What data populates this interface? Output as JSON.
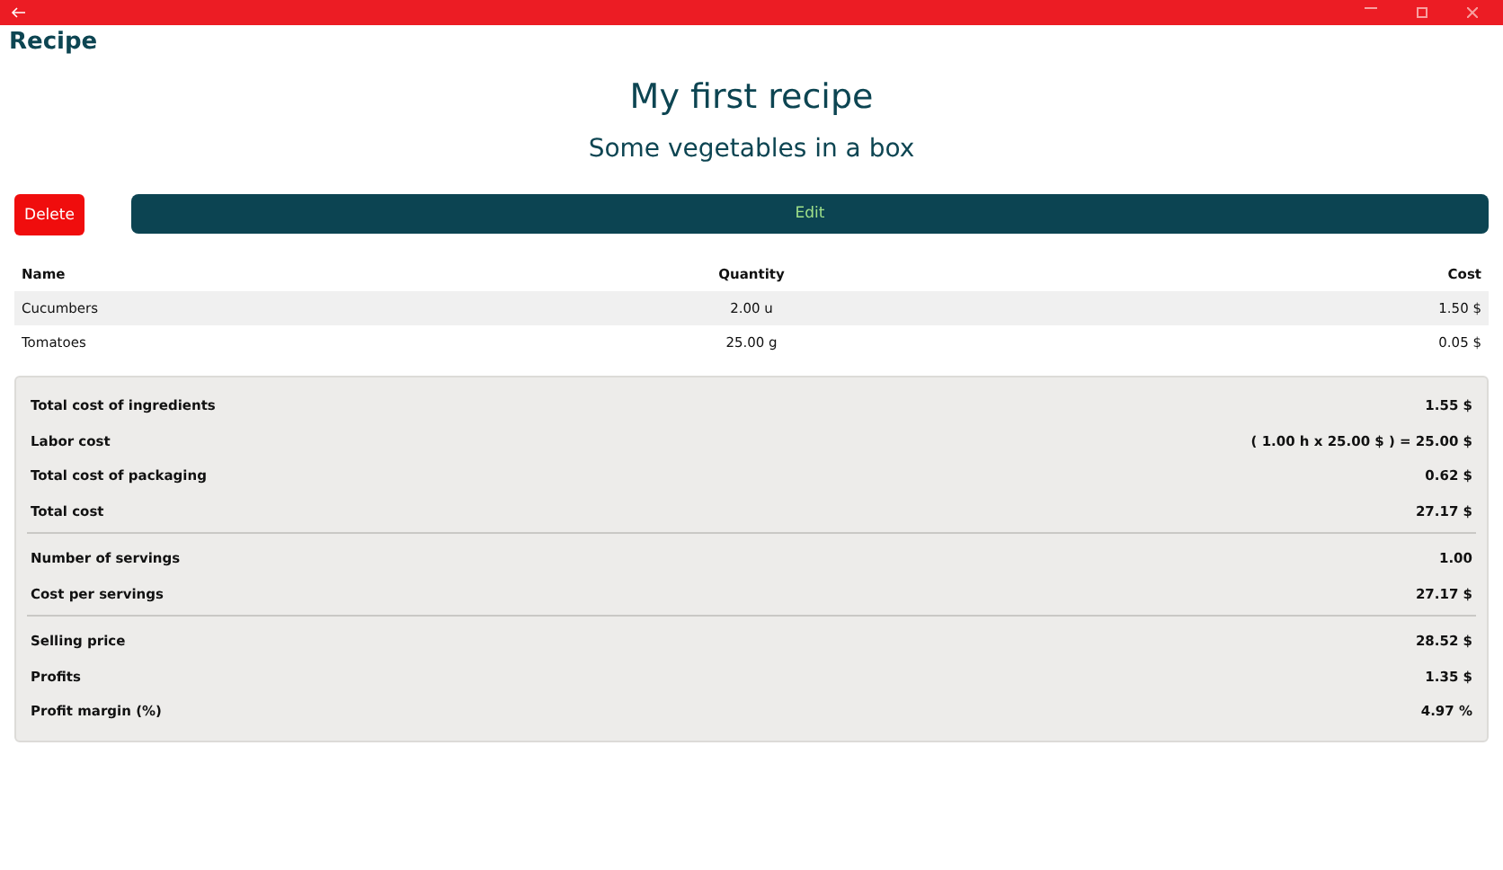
{
  "page": {
    "heading": "Recipe"
  },
  "recipe": {
    "title": "My first recipe",
    "description": "Some vegetables in a box"
  },
  "actions": {
    "delete": "Delete",
    "edit": "Edit"
  },
  "table": {
    "columns": [
      "Name",
      "Quantity",
      "Cost"
    ],
    "rows": [
      {
        "name": "Cucumbers",
        "quantity": "2.00 u",
        "cost": "1.50 $"
      },
      {
        "name": "Tomatoes",
        "quantity": "25.00 g",
        "cost": "0.05 $"
      }
    ]
  },
  "summary": {
    "groups": [
      [
        {
          "label": "Total cost of ingredients",
          "value": "1.55 $"
        },
        {
          "label": "Labor cost",
          "value": "( 1.00 h x 25.00 $ ) = 25.00 $"
        },
        {
          "label": "Total cost of packaging",
          "value": "0.62 $"
        },
        {
          "label": "Total cost",
          "value": "27.17 $"
        }
      ],
      [
        {
          "label": "Number of servings",
          "value": "1.00"
        },
        {
          "label": "Cost per servings",
          "value": "27.17 $"
        }
      ],
      [
        {
          "label": "Selling price",
          "value": "28.52 $"
        },
        {
          "label": "Profits",
          "value": "1.35 $"
        },
        {
          "label": "Profit margin (%)",
          "value": "4.97 %"
        }
      ]
    ]
  }
}
